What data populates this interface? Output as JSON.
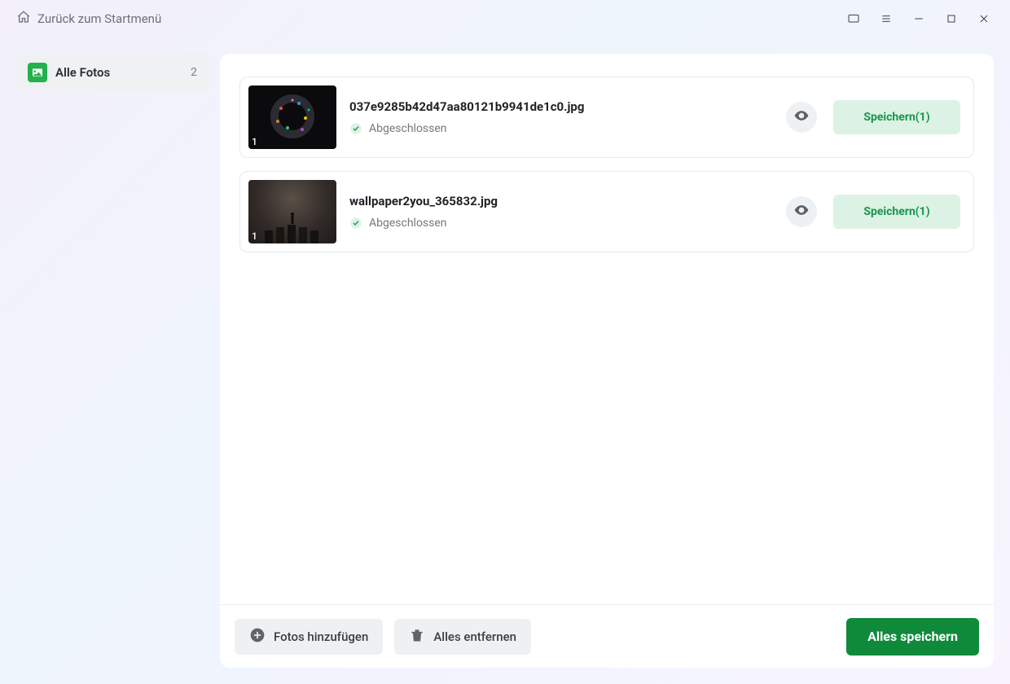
{
  "header": {
    "back_label": "Zurück zum Startmenü"
  },
  "sidebar": {
    "items": [
      {
        "label": "Alle Fotos",
        "count": "2"
      }
    ]
  },
  "list": {
    "items": [
      {
        "filename": "037e9285b42d47aa80121b9941de1c0.jpg",
        "status": "Abgeschlossen",
        "index": "1",
        "save_label": "Speichern(1)"
      },
      {
        "filename": "wallpaper2you_365832.jpg",
        "status": "Abgeschlossen",
        "index": "1",
        "save_label": "Speichern(1)"
      }
    ]
  },
  "footer": {
    "add_label": "Fotos hinzufügen",
    "remove_all_label": "Alles entfernen",
    "save_all_label": "Alles speichern"
  },
  "colors": {
    "accent": "#0f8a3b",
    "save_bg": "#dcf2e5"
  }
}
